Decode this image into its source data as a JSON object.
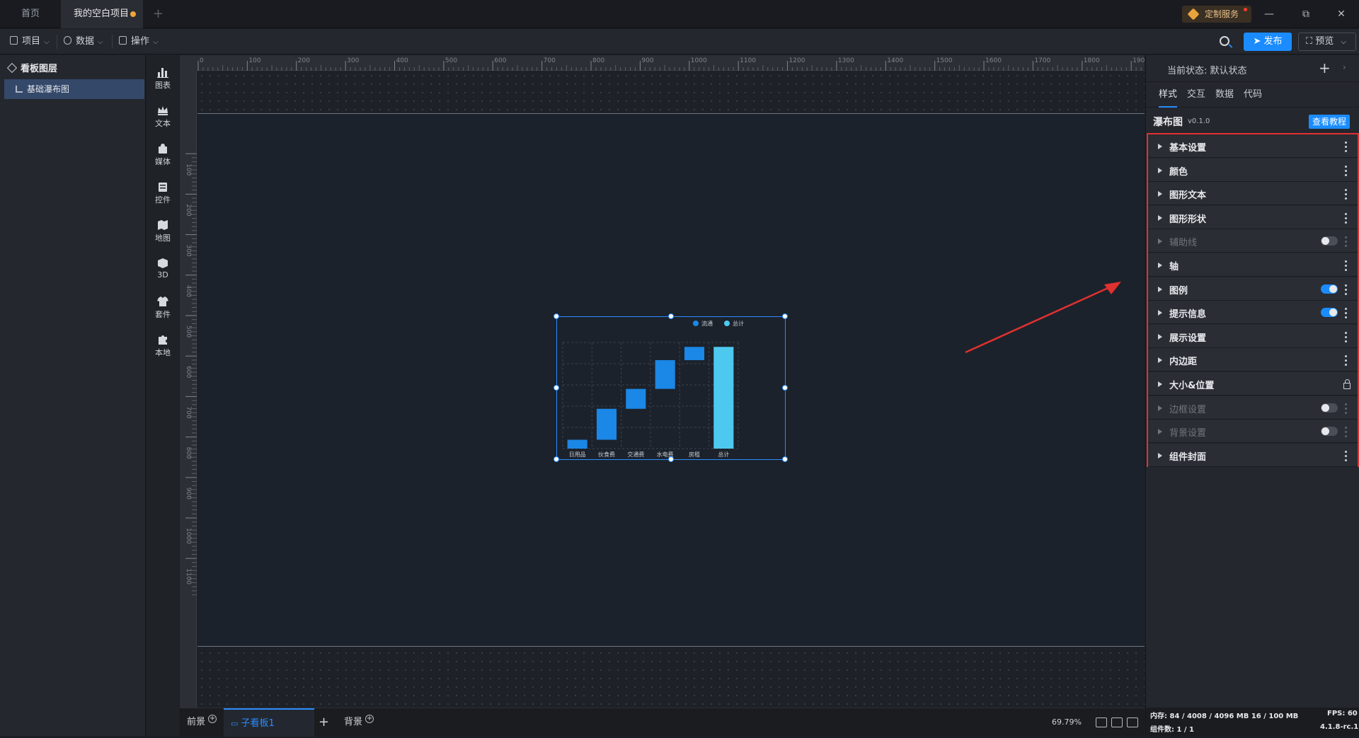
{
  "titlebar": {
    "tabs": [
      {
        "label": "首页"
      },
      {
        "label": "我的空白项目"
      }
    ],
    "custom_service": "定制服务"
  },
  "menubar": {
    "menus": [
      {
        "label": "项目"
      },
      {
        "label": "数据"
      },
      {
        "label": "操作"
      }
    ],
    "publish": "发布",
    "preview": "预览"
  },
  "layers": {
    "title": "看板图层",
    "items": [
      {
        "label": "基础瀑布图"
      }
    ]
  },
  "toolbox": {
    "tools": [
      {
        "label": "图表",
        "icon": "bar-chart-icon"
      },
      {
        "label": "文本",
        "icon": "crown-text-icon"
      },
      {
        "label": "媒体",
        "icon": "media-icon"
      },
      {
        "label": "控件",
        "icon": "widget-icon"
      },
      {
        "label": "地图",
        "icon": "map-icon"
      },
      {
        "label": "3D",
        "icon": "cube-icon"
      },
      {
        "label": "套件",
        "icon": "shirt-icon"
      },
      {
        "label": "本地",
        "icon": "puzzle-icon"
      }
    ]
  },
  "ruler": {
    "top": [
      "0",
      "100",
      "200",
      "300",
      "400",
      "500",
      "600",
      "700",
      "800",
      "900",
      "1000",
      "1100",
      "1200",
      "1300",
      "1400",
      "1500",
      "1600",
      "1700",
      "1800",
      "1900"
    ],
    "left": [
      "100",
      "200",
      "300",
      "400",
      "500",
      "600",
      "700",
      "800",
      "900",
      "1000",
      "1100"
    ]
  },
  "chart_data": {
    "type": "bar",
    "subtype": "waterfall",
    "categories": [
      "日用品",
      "伙食费",
      "交通费",
      "水电费",
      "房租",
      "总计"
    ],
    "series": [
      {
        "name": "流通",
        "color": "#1b87e6",
        "ranges": [
          [
            0,
            20
          ],
          [
            20,
            90
          ],
          [
            90,
            135
          ],
          [
            135,
            200
          ],
          [
            200,
            230
          ]
        ]
      },
      {
        "name": "总计",
        "color": "#4dc9f0",
        "ranges": [
          [
            0,
            230
          ]
        ]
      }
    ],
    "legend": [
      "流通",
      "总计"
    ],
    "legend_position": "top-right",
    "grid": true
  },
  "bottombar": {
    "tabs": [
      {
        "label": "前景"
      },
      {
        "label": "子看板1"
      },
      {
        "label": "背景"
      }
    ],
    "zoom": "69.79%"
  },
  "panel": {
    "state_label": "当前状态:  默认状态",
    "tabs": [
      {
        "label": "样式"
      },
      {
        "label": "交互"
      },
      {
        "label": "数据"
      },
      {
        "label": "代码"
      }
    ],
    "widget_name": "瀑布图",
    "widget_version": "v0.1.0",
    "tutorial": "查看教程",
    "sections": [
      {
        "label": "基本设置",
        "enabled": true,
        "control": "menu"
      },
      {
        "label": "颜色",
        "enabled": true,
        "control": "menu"
      },
      {
        "label": "图形文本",
        "enabled": true,
        "control": "menu"
      },
      {
        "label": "图形形状",
        "enabled": true,
        "control": "menu"
      },
      {
        "label": "辅助线",
        "enabled": false,
        "control": "toggle-off"
      },
      {
        "label": "轴",
        "enabled": true,
        "control": "menu"
      },
      {
        "label": "图例",
        "enabled": true,
        "control": "toggle-on"
      },
      {
        "label": "提示信息",
        "enabled": true,
        "control": "toggle-on"
      },
      {
        "label": "展示设置",
        "enabled": true,
        "control": "menu"
      },
      {
        "label": "内边距",
        "enabled": true,
        "control": "menu"
      },
      {
        "label": "大小&位置",
        "enabled": true,
        "control": "lock"
      },
      {
        "label": "边框设置",
        "enabled": false,
        "control": "toggle-off"
      },
      {
        "label": "背景设置",
        "enabled": false,
        "control": "toggle-off"
      },
      {
        "label": "组件封面",
        "enabled": true,
        "control": "menu"
      }
    ]
  },
  "status": {
    "memory": "内存:  84 / 4008 / 4096 MB  16 / 100 MB",
    "fps": "FPS:  60",
    "count": "组件数: 1 / 1",
    "version": "4.1.8-rc.1"
  }
}
